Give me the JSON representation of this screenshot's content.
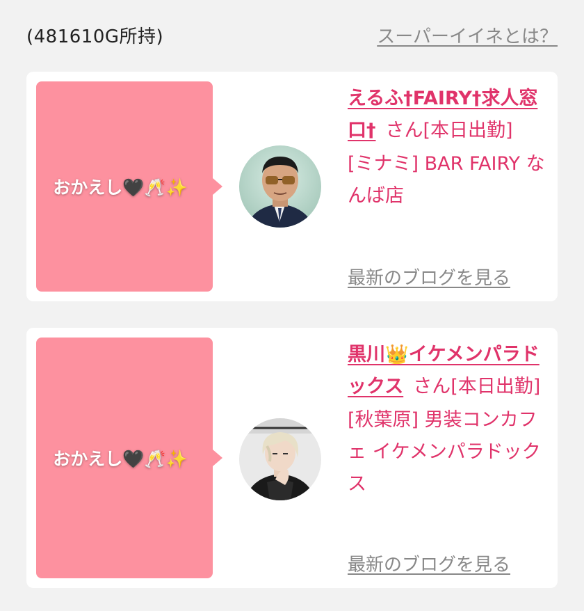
{
  "header": {
    "points_text": "(481610G所持)",
    "help_link": "スーパーイイネとは？"
  },
  "cards": [
    {
      "message": "おかえし🖤🥂✨",
      "shop_name": "えるふ†FAIRY†求人窓口†",
      "honorific_suffix": "さん[本日出勤]",
      "location": "[ミナミ] BAR FAIRY なんば店",
      "blog_link": "最新のブログを見る",
      "avatar_icon": "man-sunglasses-avatar-icon"
    },
    {
      "message": "おかえし🖤🥂✨",
      "shop_name": "黒川👑イケメンパラドックス",
      "honorific_suffix": "さん[本日出勤]",
      "location": "[秋葉原] 男装コンカフェ イケメンパラドックス",
      "blog_link": "最新のブログを見る",
      "avatar_icon": "blonde-host-avatar-icon"
    }
  ],
  "colors": {
    "accent_pink": "#e0336a",
    "bubble_pink": "#fd919f",
    "background": "#f2f2f2",
    "link_gray": "#888888"
  }
}
